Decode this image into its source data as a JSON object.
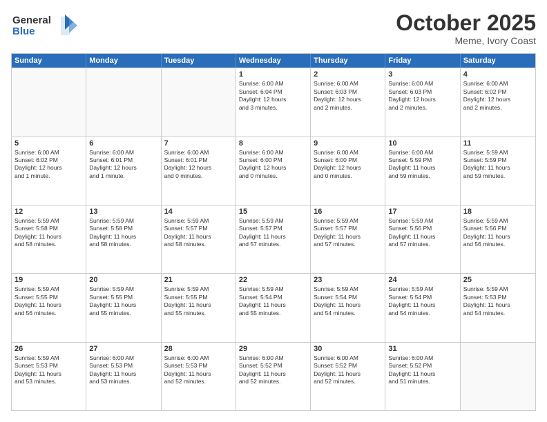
{
  "header": {
    "logo_line1": "General",
    "logo_line2": "Blue",
    "month": "October 2025",
    "location": "Meme, Ivory Coast"
  },
  "days_of_week": [
    "Sunday",
    "Monday",
    "Tuesday",
    "Wednesday",
    "Thursday",
    "Friday",
    "Saturday"
  ],
  "weeks": [
    [
      {
        "day": "",
        "info": ""
      },
      {
        "day": "",
        "info": ""
      },
      {
        "day": "",
        "info": ""
      },
      {
        "day": "1",
        "info": "Sunrise: 6:00 AM\nSunset: 6:04 PM\nDaylight: 12 hours\nand 3 minutes."
      },
      {
        "day": "2",
        "info": "Sunrise: 6:00 AM\nSunset: 6:03 PM\nDaylight: 12 hours\nand 2 minutes."
      },
      {
        "day": "3",
        "info": "Sunrise: 6:00 AM\nSunset: 6:03 PM\nDaylight: 12 hours\nand 2 minutes."
      },
      {
        "day": "4",
        "info": "Sunrise: 6:00 AM\nSunset: 6:02 PM\nDaylight: 12 hours\nand 2 minutes."
      }
    ],
    [
      {
        "day": "5",
        "info": "Sunrise: 6:00 AM\nSunset: 6:02 PM\nDaylight: 12 hours\nand 1 minute."
      },
      {
        "day": "6",
        "info": "Sunrise: 6:00 AM\nSunset: 6:01 PM\nDaylight: 12 hours\nand 1 minute."
      },
      {
        "day": "7",
        "info": "Sunrise: 6:00 AM\nSunset: 6:01 PM\nDaylight: 12 hours\nand 0 minutes."
      },
      {
        "day": "8",
        "info": "Sunrise: 6:00 AM\nSunset: 6:00 PM\nDaylight: 12 hours\nand 0 minutes."
      },
      {
        "day": "9",
        "info": "Sunrise: 6:00 AM\nSunset: 6:00 PM\nDaylight: 12 hours\nand 0 minutes."
      },
      {
        "day": "10",
        "info": "Sunrise: 6:00 AM\nSunset: 5:59 PM\nDaylight: 11 hours\nand 59 minutes."
      },
      {
        "day": "11",
        "info": "Sunrise: 5:59 AM\nSunset: 5:59 PM\nDaylight: 11 hours\nand 59 minutes."
      }
    ],
    [
      {
        "day": "12",
        "info": "Sunrise: 5:59 AM\nSunset: 5:58 PM\nDaylight: 11 hours\nand 58 minutes."
      },
      {
        "day": "13",
        "info": "Sunrise: 5:59 AM\nSunset: 5:58 PM\nDaylight: 11 hours\nand 58 minutes."
      },
      {
        "day": "14",
        "info": "Sunrise: 5:59 AM\nSunset: 5:57 PM\nDaylight: 11 hours\nand 58 minutes."
      },
      {
        "day": "15",
        "info": "Sunrise: 5:59 AM\nSunset: 5:57 PM\nDaylight: 11 hours\nand 57 minutes."
      },
      {
        "day": "16",
        "info": "Sunrise: 5:59 AM\nSunset: 5:57 PM\nDaylight: 11 hours\nand 57 minutes."
      },
      {
        "day": "17",
        "info": "Sunrise: 5:59 AM\nSunset: 5:56 PM\nDaylight: 11 hours\nand 57 minutes."
      },
      {
        "day": "18",
        "info": "Sunrise: 5:59 AM\nSunset: 5:56 PM\nDaylight: 11 hours\nand 56 minutes."
      }
    ],
    [
      {
        "day": "19",
        "info": "Sunrise: 5:59 AM\nSunset: 5:55 PM\nDaylight: 11 hours\nand 56 minutes."
      },
      {
        "day": "20",
        "info": "Sunrise: 5:59 AM\nSunset: 5:55 PM\nDaylight: 11 hours\nand 55 minutes."
      },
      {
        "day": "21",
        "info": "Sunrise: 5:59 AM\nSunset: 5:55 PM\nDaylight: 11 hours\nand 55 minutes."
      },
      {
        "day": "22",
        "info": "Sunrise: 5:59 AM\nSunset: 5:54 PM\nDaylight: 11 hours\nand 55 minutes."
      },
      {
        "day": "23",
        "info": "Sunrise: 5:59 AM\nSunset: 5:54 PM\nDaylight: 11 hours\nand 54 minutes."
      },
      {
        "day": "24",
        "info": "Sunrise: 5:59 AM\nSunset: 5:54 PM\nDaylight: 11 hours\nand 54 minutes."
      },
      {
        "day": "25",
        "info": "Sunrise: 5:59 AM\nSunset: 5:53 PM\nDaylight: 11 hours\nand 54 minutes."
      }
    ],
    [
      {
        "day": "26",
        "info": "Sunrise: 5:59 AM\nSunset: 5:53 PM\nDaylight: 11 hours\nand 53 minutes."
      },
      {
        "day": "27",
        "info": "Sunrise: 6:00 AM\nSunset: 5:53 PM\nDaylight: 11 hours\nand 53 minutes."
      },
      {
        "day": "28",
        "info": "Sunrise: 6:00 AM\nSunset: 5:53 PM\nDaylight: 11 hours\nand 52 minutes."
      },
      {
        "day": "29",
        "info": "Sunrise: 6:00 AM\nSunset: 5:52 PM\nDaylight: 11 hours\nand 52 minutes."
      },
      {
        "day": "30",
        "info": "Sunrise: 6:00 AM\nSunset: 5:52 PM\nDaylight: 11 hours\nand 52 minutes."
      },
      {
        "day": "31",
        "info": "Sunrise: 6:00 AM\nSunset: 5:52 PM\nDaylight: 11 hours\nand 51 minutes."
      },
      {
        "day": "",
        "info": ""
      }
    ]
  ]
}
